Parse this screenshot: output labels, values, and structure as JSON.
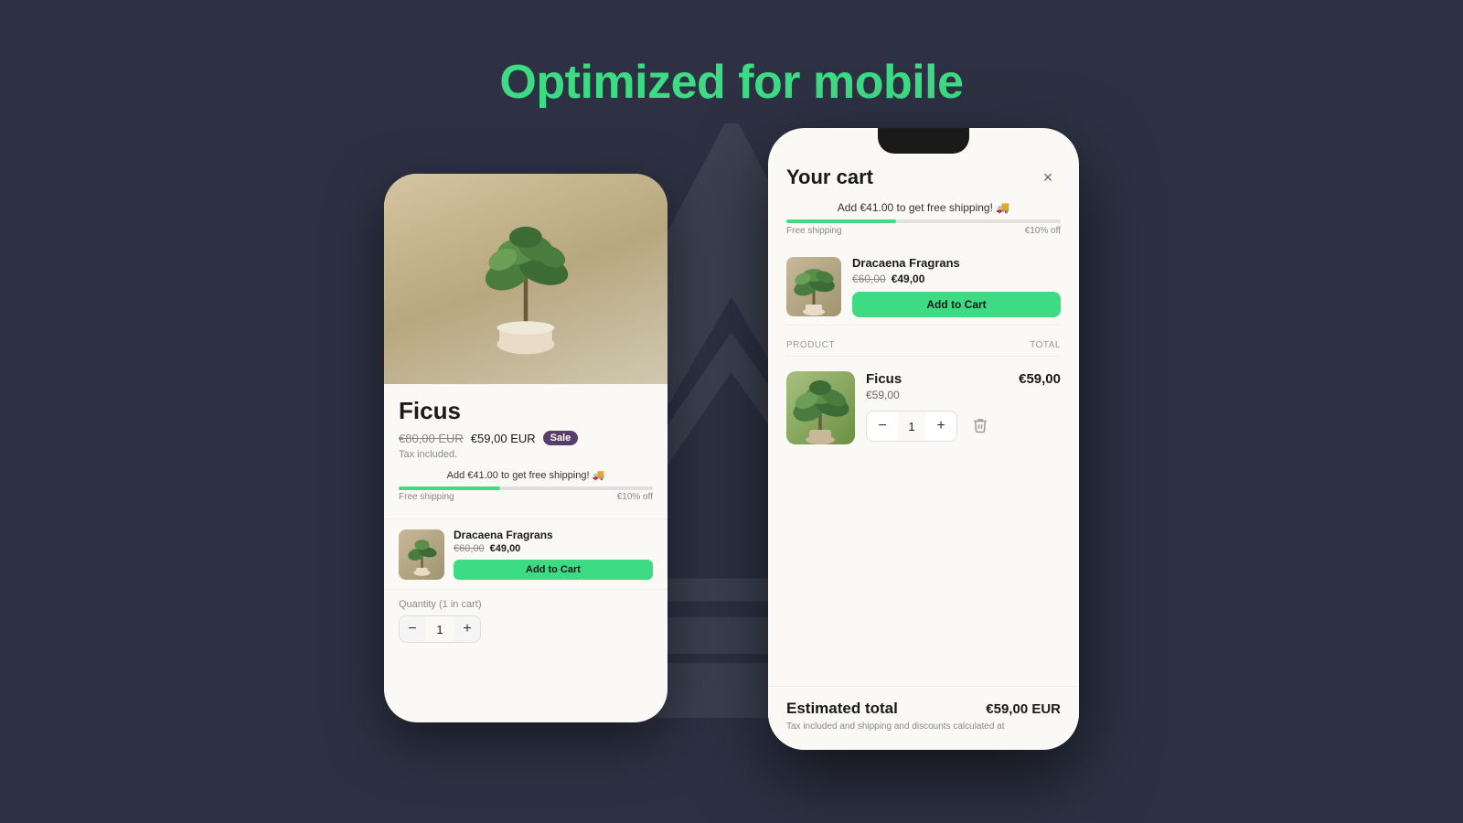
{
  "page": {
    "title": "Optimized for mobile",
    "background_color": "#2d3143",
    "accent_color": "#3ddc84"
  },
  "left_phone": {
    "product_name": "Ficus",
    "price_original": "€80,00 EUR",
    "price_sale": "€59,00 EUR",
    "sale_badge": "Sale",
    "tax_note": "Tax included.",
    "shipping_banner": "Add €41.00 to get free shipping! 🚚",
    "progress_percent": 40,
    "free_shipping_label": "Free shipping",
    "discount_label": "€10% off",
    "upsell_name": "Dracaena Fragrans",
    "upsell_original": "€60,00",
    "upsell_sale": "€49,00",
    "upsell_btn": "Add to Cart",
    "quantity_label": "Quantity (1 in cart)",
    "quantity_value": "1",
    "qty_minus": "−",
    "qty_plus": "+"
  },
  "right_phone": {
    "cart_title": "Your cart",
    "close_icon": "×",
    "shipping_banner": "Add €41.00 to get free shipping! 🚚",
    "progress_percent": 40,
    "free_shipping_label": "Free shipping",
    "discount_label": "€10% off",
    "upsell_name": "Dracaena Fragrans",
    "upsell_original": "€60,00",
    "upsell_sale": "€49,00",
    "add_to_cart_btn": "Add to Cart",
    "col_product": "PRODUCT",
    "col_total": "TOTAL",
    "item_name": "Ficus",
    "item_price": "€59,00",
    "item_total": "€59,00",
    "item_qty": "1",
    "qty_minus": "−",
    "qty_plus": "+",
    "estimated_total_label": "Estimated total",
    "estimated_total_value": "€59,00 EUR",
    "footer_note": "Tax included and shipping and discounts calculated at"
  }
}
